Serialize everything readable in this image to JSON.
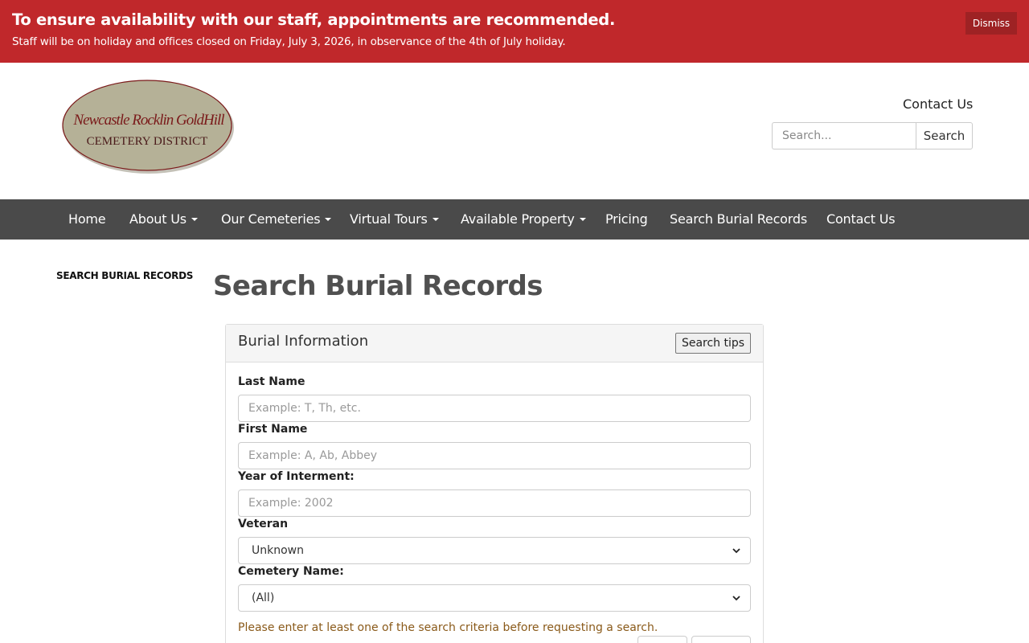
{
  "alert": {
    "title": "To ensure availability with our staff, appointments are recommended.",
    "message": "Staff will be on holiday and offices closed on Friday, July 3, 2026, in observance of the 4th of July holiday.",
    "dismiss_label": "Dismiss"
  },
  "logo": {
    "line1": "Newcastle Rocklin GoldHill",
    "line2": "CEMETERY DISTRICT"
  },
  "header": {
    "contact_label": "Contact Us",
    "search_placeholder": "Search...",
    "search_button": "Search"
  },
  "nav": {
    "items": [
      {
        "label": "Home",
        "dropdown": false
      },
      {
        "label": "About Us",
        "dropdown": true
      },
      {
        "label": "Our Cemeteries",
        "dropdown": true
      },
      {
        "label": "Virtual Tours",
        "dropdown": true
      },
      {
        "label": "Available Property",
        "dropdown": true
      },
      {
        "label": "Pricing",
        "dropdown": false
      },
      {
        "label": "Search Burial Records",
        "dropdown": false
      },
      {
        "label": "Contact Us",
        "dropdown": false
      }
    ]
  },
  "sidebar": {
    "link_label": "SEARCH BURIAL RECORDS"
  },
  "page": {
    "title": "Search Burial Records"
  },
  "form": {
    "panel_title": "Burial Information",
    "tips_button": "Search tips",
    "last_name_label": "Last Name",
    "last_name_placeholder": "Example: T, Th, etc.",
    "first_name_label": "First Name",
    "first_name_placeholder": "Example: A, Ab, Abbey",
    "year_label": "Year of Interment:",
    "year_placeholder": "Example: 2002",
    "veteran_label": "Veteran",
    "veteran_value": "Unknown",
    "cemetery_label": "Cemetery Name:",
    "cemetery_value": "(All)",
    "hint": "Please enter at least one of the search criteria before requesting a search."
  },
  "colors": {
    "alert_bg": "#c0282b",
    "navbar_bg": "#4a4a4a",
    "logo_fill": "#b5b197",
    "logo_text": "#7a1a1a"
  }
}
